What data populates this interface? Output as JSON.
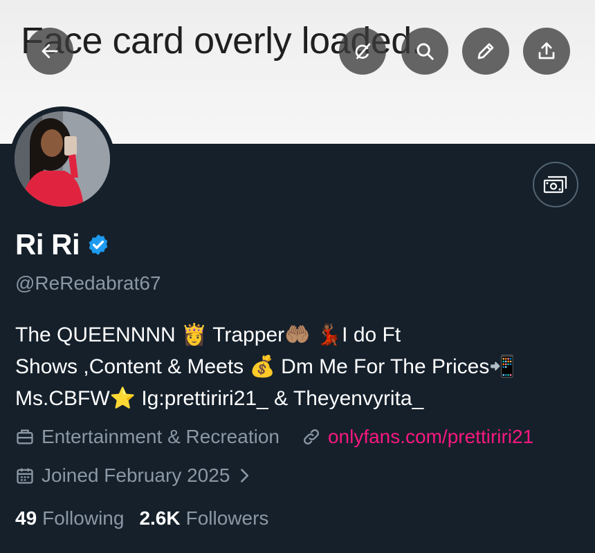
{
  "banner": {
    "text": "Face card overly loaded."
  },
  "profile": {
    "display_name": "Ri Ri",
    "handle": "@ReRedabrat67",
    "bio_line1": "The QUEENNNN 👸 Trapper🤲🏽 💃🏾I do Ft",
    "bio_line2": "Shows ,Content & Meets 💰 Dm Me For The Prices📲",
    "bio_line3": "Ms.CBFW⭐ Ig:prettiriri21_ & Theyenvyrita_",
    "category": "Entertainment & Recreation",
    "link": "onlyfans.com/prettiriri21",
    "joined": "Joined February 2025"
  },
  "stats": {
    "following_count": "49",
    "following_label": "Following",
    "followers_count": "2.6K",
    "followers_label": "Followers"
  },
  "icons": {
    "back": "back-arrow-icon",
    "grok": "grok-icon",
    "search": "search-icon",
    "edit": "pencil-icon",
    "share": "share-icon",
    "money": "money-icon",
    "verified": "verified-badge-icon",
    "briefcase": "briefcase-icon",
    "link": "link-icon",
    "calendar": "calendar-icon",
    "chevron": "chevron-right-icon"
  },
  "colors": {
    "background": "#15202b",
    "muted_text": "#8b98a5",
    "link": "#f91880",
    "verified": "#1d9bf0"
  }
}
